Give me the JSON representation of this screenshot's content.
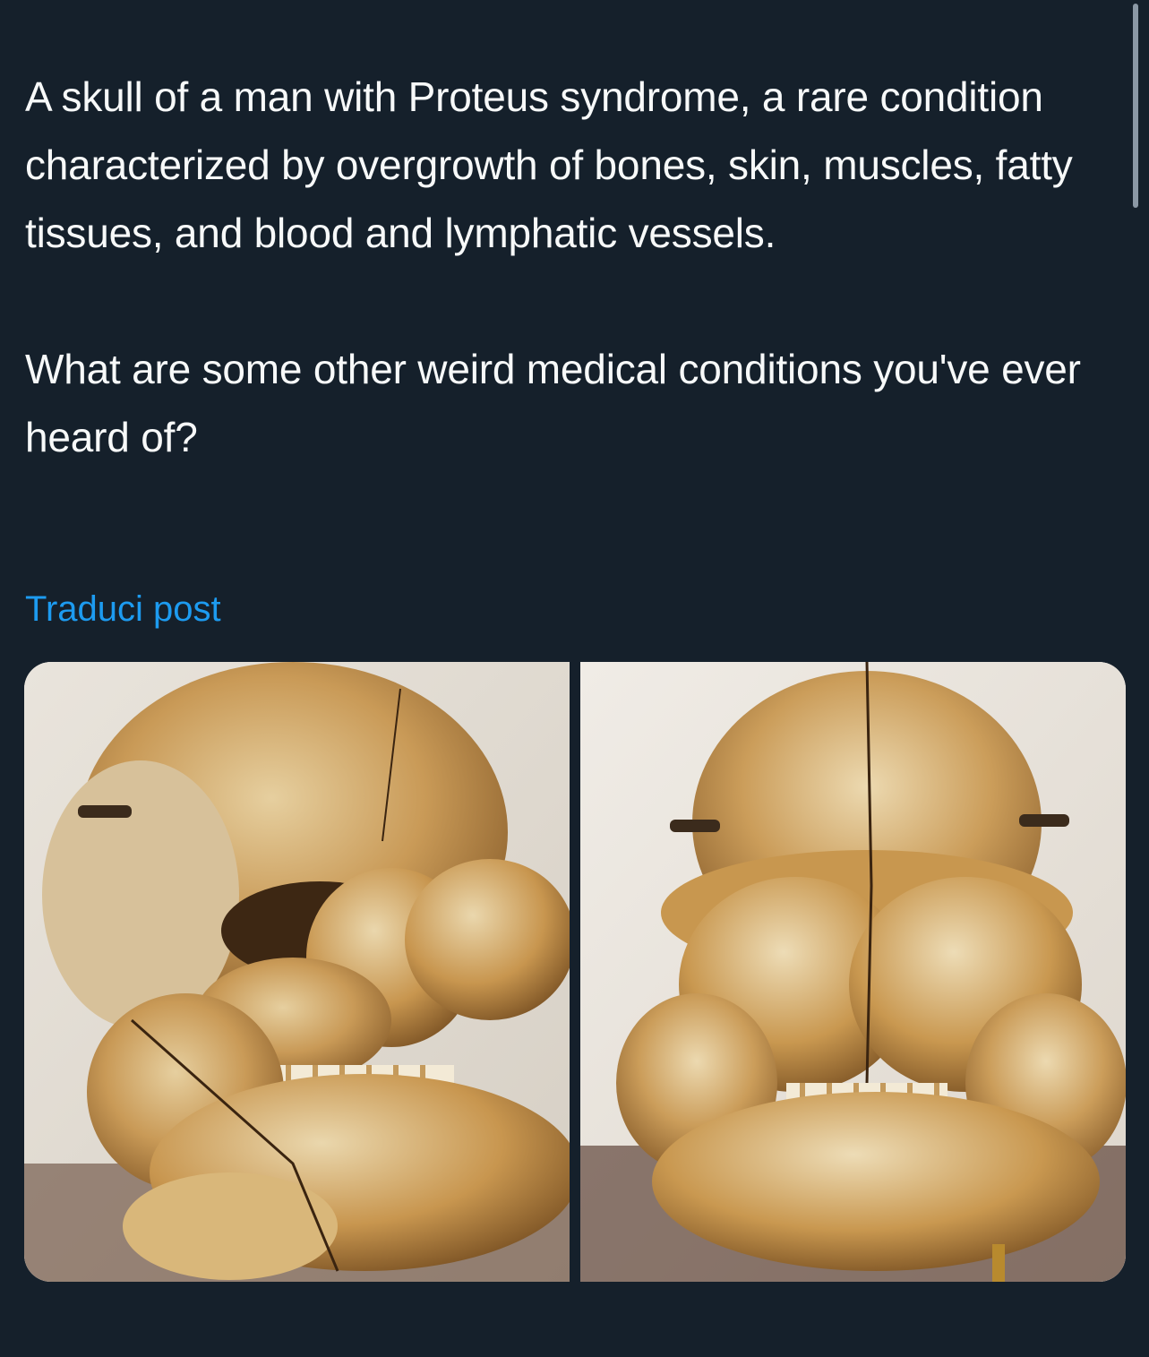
{
  "post": {
    "paragraph_1": "A skull of a man with Proteus syndrome, a rare condition characterized by overgrowth of bones, skin, muscles, fatty tissues, and blood and lymphatic vessels.",
    "paragraph_2": "What are some other weird medical conditions you've ever heard of?",
    "translate_label": "Traduci post"
  },
  "media": {
    "count": 2,
    "subject": "skull-photo"
  },
  "colors": {
    "background": "#15202b",
    "text": "#f7f9f9",
    "link": "#1d9bf0",
    "muted": "#8b98a5"
  }
}
